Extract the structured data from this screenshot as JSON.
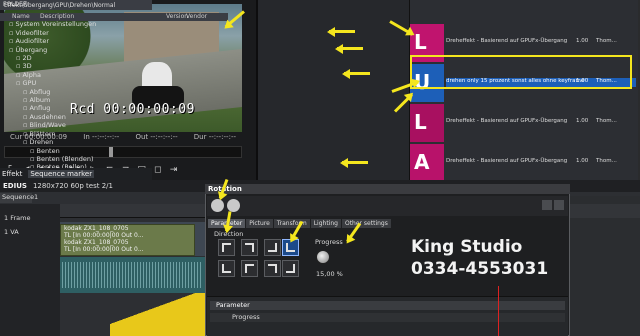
{
  "preview": {
    "timecode": "Rcd 00:00:00:09",
    "status_cur": "Cur 00:00:00:09",
    "status_in": "In --:--:--:--",
    "status_out": "Out --:--:--:--",
    "status_dur": "Dur --:--:--:--",
    "controls": [
      "⌜",
      "◀",
      "◀◀",
      "▶",
      "▶▶",
      "▷",
      "⊏",
      "⊐",
      "□",
      "◻",
      "⇥"
    ]
  },
  "effects": {
    "header": "FOLDER",
    "tree": [
      {
        "label": "Effekt",
        "indent": 0
      },
      {
        "label": "System Voreinstellungen",
        "indent": 1
      },
      {
        "label": "Videofilter",
        "indent": 1
      },
      {
        "label": "Audiofilter",
        "indent": 1
      },
      {
        "label": "Übergang",
        "indent": 1
      },
      {
        "label": "2D",
        "indent": 2
      },
      {
        "label": "3D",
        "indent": 2
      },
      {
        "label": "Alpha",
        "indent": 2
      },
      {
        "label": "GPU",
        "indent": 2
      },
      {
        "label": "Abflug",
        "indent": 3
      },
      {
        "label": "Album",
        "indent": 3
      },
      {
        "label": "Anflug",
        "indent": 3
      },
      {
        "label": "Ausdehnen",
        "indent": 3
      },
      {
        "label": "Blind/Wave",
        "indent": 3
      },
      {
        "label": "Blättern",
        "indent": 3
      },
      {
        "label": "Drehen",
        "indent": 3
      },
      {
        "label": "Benten",
        "indent": 4
      },
      {
        "label": "Benten (Blenden)",
        "indent": 4
      },
      {
        "label": "Benten (Rollen)",
        "indent": 4
      },
      {
        "label": "Normal",
        "indent": 4
      }
    ],
    "tabs": [
      "Effekt",
      "Sequence marker"
    ]
  },
  "thumbs": {
    "title": "Effekt\\Übergang\\GPU\\Drehen\\Normal",
    "columns": [
      "Name",
      "Description",
      "Version",
      "Vendor"
    ],
    "rows": [
      {
        "desc": "Dreheffekt - Basierend auf GPUFx-Übergang",
        "version": "1.00",
        "vendor": "Thom..."
      },
      {
        "desc": "drehen only 15 prozent  sonst alles ohne keyframe",
        "version": "1.00",
        "vendor": "Thom..."
      },
      {
        "desc": "Dreheffekt - Basierend auf GPUFx-Übergang",
        "version": "1.00",
        "vendor": "Thom..."
      },
      {
        "desc": "Dreheffekt - Basierend auf GPUFx-Übergang",
        "version": "1.00",
        "vendor": "Thom..."
      }
    ]
  },
  "timeline": {
    "app": "EDIUS",
    "format": "1280x720 60p test 2/1",
    "sequence": "Sequence1",
    "frame": "1 Frame",
    "track_v": "1 VA",
    "clip_line1": "kodak ZX1_108_0705",
    "clip_line2": "TL [In 00:00:00|00 Out 0...",
    "clip_line3": "kodak ZX1_108_0705",
    "clip_line4": "TL [In 00:00:00|00 Out 0..."
  },
  "dialog": {
    "title": "Rotation",
    "tabs": [
      "Parameter",
      "Picture",
      "Transform",
      "Lighting",
      "Other settings"
    ],
    "direction_label": "Direction",
    "progress_label": "Progress",
    "progress_value": "15,00 %",
    "param_row": "Parameter",
    "prog_row": "Progress"
  },
  "watermark": {
    "line1": "King Studio",
    "line2": "0334-4553031"
  }
}
